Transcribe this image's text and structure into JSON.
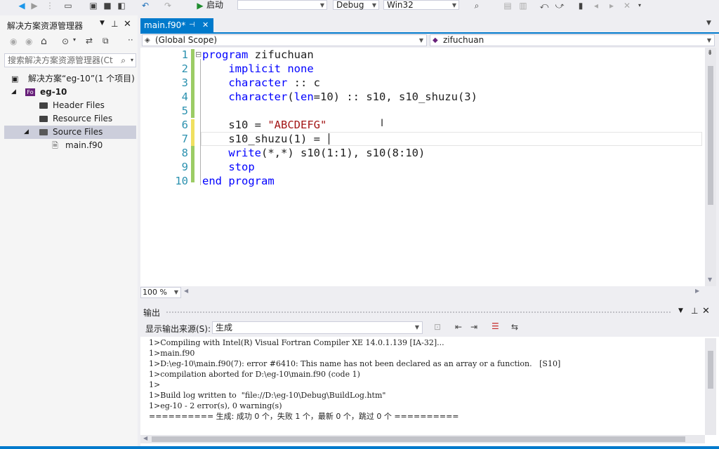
{
  "toolbar": {
    "start_label": "启动",
    "config": "Debug",
    "platform": "Win32",
    "icons": [
      "back-icon",
      "forward-icon",
      "new-project-icon",
      "open-icon",
      "save-icon",
      "save-all-icon",
      "undo-icon",
      "redo-icon",
      "start-icon",
      "find-icon",
      "bookmark-icon"
    ]
  },
  "solution_explorer": {
    "title": "解决方案资源管理器",
    "search_placeholder": "搜索解决方案资源管理器(Ct",
    "tree": [
      {
        "label": "解决方案“eg-10”(1 个项目)",
        "indent": 0
      },
      {
        "label": "eg-10",
        "indent": 1,
        "badge": "Fo"
      },
      {
        "label": "Header Files",
        "indent": 2
      },
      {
        "label": "Resource Files",
        "indent": 2
      },
      {
        "label": "Source Files",
        "indent": 2,
        "selected": true
      },
      {
        "label": "main.f90",
        "indent": 3
      }
    ]
  },
  "editor": {
    "tab_label": "main.f90*",
    "scope": "(Global Scope)",
    "member": "zifuchuan",
    "zoom": "100 %",
    "lines": [
      {
        "n": "1",
        "text": "program zifuchuan"
      },
      {
        "n": "2",
        "text": "    implicit none"
      },
      {
        "n": "3",
        "text": "    character :: c"
      },
      {
        "n": "4",
        "text": "    character(len=10) :: s10, s10_shuzu(3)"
      },
      {
        "n": "5",
        "text": ""
      },
      {
        "n": "6",
        "text": "    s10 = \"ABCDEFG\""
      },
      {
        "n": "7",
        "text": "    s10_shuzu(1) ="
      },
      {
        "n": "8",
        "text": "    write(*,*) s10(1:1), s10(8:10)"
      },
      {
        "n": "9",
        "text": "    stop"
      },
      {
        "n": "10",
        "text": "end program"
      }
    ]
  },
  "output": {
    "title": "输出",
    "source_label": "显示输出来源(S):",
    "source_value": "生成",
    "lines": [
      "1>Compiling with Intel(R) Visual Fortran Compiler XE 14.0.1.139 [IA-32]...",
      "1>main.f90",
      "1>D:\\eg-10\\main.f90(7): error #6410: This name has not been declared as an array or a function.   [S10]",
      "1>compilation aborted for D:\\eg-10\\main.f90 (code 1)",
      "1>",
      "1>Build log written to  \"file://D:\\eg-10\\Debug\\BuildLog.htm\"",
      "1>eg-10 - 2 error(s), 0 warning(s)",
      "========== 生成: 成功 0 个，失败 1 个，最新 0 个，跳过 0 个 =========="
    ]
  },
  "colors": {
    "accent": "#007acc",
    "keyword": "#0000ff",
    "string": "#a31515",
    "linenum": "#2b91af",
    "change_mark": "#f0e060"
  }
}
